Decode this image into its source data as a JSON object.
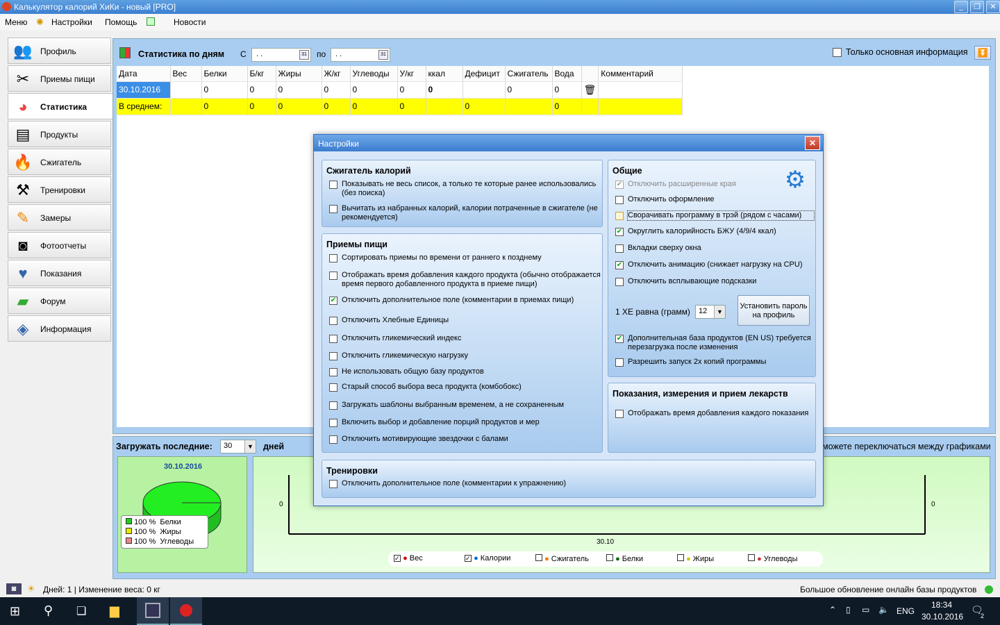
{
  "window": {
    "title": "Калькулятор калорий ХиКи - новый [PRO]"
  },
  "menu": {
    "items": [
      "Меню",
      "Настройки",
      "Помощь",
      "Новости"
    ]
  },
  "sidebar": {
    "items": [
      {
        "label": "Профиль",
        "icon": "profile-icon"
      },
      {
        "label": "Приемы пищи",
        "icon": "fork-knife-icon"
      },
      {
        "label": "Статистика",
        "icon": "pie-chart-icon"
      },
      {
        "label": "Продукты",
        "icon": "products-icon"
      },
      {
        "label": "Сжигатель",
        "icon": "flame-icon"
      },
      {
        "label": "Тренировки",
        "icon": "dumbbell-icon"
      },
      {
        "label": "Замеры",
        "icon": "pencil-icon"
      },
      {
        "label": "Фотоотчеты",
        "icon": "camera-icon"
      },
      {
        "label": "Показания",
        "icon": "heartbeat-icon"
      },
      {
        "label": "Форум",
        "icon": "chat-icon"
      },
      {
        "label": "Информация",
        "icon": "info-icon"
      }
    ]
  },
  "stats": {
    "title": "Статистика по дням",
    "from_label": "С",
    "to_label": "по",
    "from_value": ". .",
    "to_value": ". .",
    "only_main_label": "Только основная информация",
    "columns": [
      "Дата",
      "Вес",
      "Белки",
      "Б/кг",
      "Жиры",
      "Ж/кг",
      "Углеводы",
      "У/кг",
      "ккал",
      "Дефицит",
      "Сжигатель",
      "Вода",
      "",
      "Комментарий"
    ],
    "row": {
      "date": "30.10.2016",
      "cells": [
        "",
        "0",
        "0",
        "0",
        "0",
        "0",
        "0",
        "0",
        "",
        "0",
        "0"
      ]
    },
    "avg": {
      "label": "В среднем:",
      "cells": [
        "",
        "0",
        "0",
        "0",
        "0",
        "0",
        "0",
        "",
        "0",
        "",
        "0"
      ]
    }
  },
  "bottom": {
    "load_label": "Загружать последние:",
    "load_value": "30",
    "days_label": "дней",
    "hint": "можете переключаться между графиками",
    "pie_date": "30.10.2016",
    "pie_legend": [
      {
        "pct": "100 %",
        "name": "Белки",
        "color": "#22cc22"
      },
      {
        "pct": "100 %",
        "name": "Жиры",
        "color": "#e8e800"
      },
      {
        "pct": "100 %",
        "name": "Углеводы",
        "color": "#e88888"
      }
    ],
    "chart_left_zero": "0",
    "chart_right_zero": "0",
    "chart_x_label": "30.10",
    "legend": [
      {
        "name": "Вес",
        "checked": true,
        "color": "#cc0000"
      },
      {
        "name": "Калории",
        "checked": true,
        "color": "#0066cc"
      },
      {
        "name": "Сжигатель",
        "checked": false,
        "color": "#e07000"
      },
      {
        "name": "Белки",
        "checked": false,
        "color": "#006600"
      },
      {
        "name": "Жиры",
        "checked": false,
        "color": "#d4c000"
      },
      {
        "name": "Углеводы",
        "checked": false,
        "color": "#cc3333"
      }
    ]
  },
  "status": {
    "left": "Дней: 1 | Изменение веса: 0 кг",
    "right": "Большое обновление онлайн базы продуктов"
  },
  "taskbar": {
    "lang": "ENG",
    "time": "18:34",
    "date": "30.10.2016",
    "notif": "2"
  },
  "dialog": {
    "title": "Настройки",
    "burner": {
      "title": "Сжигатель калорий",
      "options": [
        {
          "label": "Показывать не весь список, а только те которые ранее использовались (без поиска)",
          "checked": false
        },
        {
          "label": "Вычитать из набранных калорий, калории потраченные в сжигателе (не рекомендуется)",
          "checked": false
        }
      ]
    },
    "meals": {
      "title": "Приемы пищи",
      "options": [
        {
          "label": "Сортировать приемы по времени от раннего к позднему",
          "checked": false
        },
        {
          "label": "Отображать время добавления каждого продукта (обычно отображается время первого добавленного продукта в приеме пищи)",
          "checked": false
        },
        {
          "label": "Отключить дополнительное поле (комментарии в приемах пищи)",
          "checked": true
        },
        {
          "label": "Отключить Хлебные Единицы",
          "checked": false
        },
        {
          "label": "Отключить гликемический индекс",
          "checked": false
        },
        {
          "label": "Отключить гликемическую нагрузку",
          "checked": false
        },
        {
          "label": "Не использовать общую базу продуктов",
          "checked": false
        },
        {
          "label": "Старый способ выбора веса продукта (комбобокс)",
          "checked": false
        },
        {
          "label": "Загружать шаблоны выбранным временем, а не сохраненным",
          "checked": false
        },
        {
          "label": "Включить выбор и добавление порций продуктов и мер",
          "checked": false
        },
        {
          "label": "Отключить мотивирующие звездочки с балами",
          "checked": false
        }
      ]
    },
    "workouts": {
      "title": "Тренировки",
      "options": [
        {
          "label": "Отключить дополнительное поле (комментарии к упражнению)",
          "checked": false
        }
      ]
    },
    "general": {
      "title": "Общие",
      "options": [
        {
          "label": "Отключить расширенные края",
          "checked": true,
          "disabled": true
        },
        {
          "label": "Отключить оформление",
          "checked": false
        },
        {
          "label": "Сворачивать программу в трэй (рядом с часами)",
          "checked": false
        },
        {
          "label": "Округлить калорийность БЖУ (4/9/4 ккал)",
          "checked": true
        },
        {
          "label": "Вкладки сверху окна",
          "checked": false
        },
        {
          "label": "Отключить анимацию (снижает нагрузку на CPU)",
          "checked": true
        },
        {
          "label": "Отключить всплывающие подсказки",
          "checked": false
        }
      ],
      "xe_label": "1 ХЕ равна (грамм)",
      "xe_value": "12",
      "password_button": "Установить пароль на профиль",
      "extra_options": [
        {
          "label": "Дополнительная база продуктов (EN US) требуется перезагрузка после изменения",
          "checked": true
        },
        {
          "label": "Разрешить запуск 2х копий программы",
          "checked": false
        }
      ]
    },
    "readings": {
      "title": "Показания, измерения и прием лекарств",
      "options": [
        {
          "label": "Отображать время добавления каждого показания",
          "checked": false
        }
      ]
    }
  }
}
